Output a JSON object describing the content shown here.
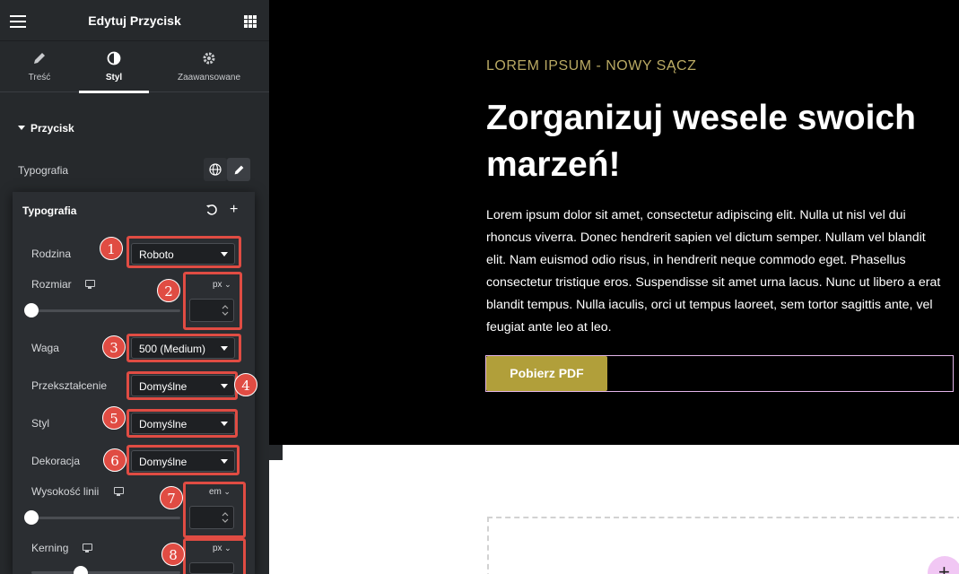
{
  "panel": {
    "title": "Edytuj Przycisk",
    "tabs": [
      {
        "label": "Treść",
        "icon": "pencil-icon"
      },
      {
        "label": "Styl",
        "icon": "half-circle-icon",
        "active": true
      },
      {
        "label": "Zaawansowane",
        "icon": "gear-icon"
      }
    ],
    "section_title": "Przycisk",
    "typography_label": "Typografia"
  },
  "popover": {
    "title": "Typografia",
    "fields": {
      "family": {
        "label": "Rodzina",
        "value": "Roboto"
      },
      "size": {
        "label": "Rozmiar",
        "unit": "px",
        "value": ""
      },
      "weight": {
        "label": "Waga",
        "value": "500 (Medium)"
      },
      "transform": {
        "label": "Przekształcenie",
        "value": "Domyślne"
      },
      "style": {
        "label": "Styl",
        "value": "Domyślne"
      },
      "decoration": {
        "label": "Dekoracja",
        "value": "Domyślne"
      },
      "line_height": {
        "label": "Wysokość linii",
        "unit": "em",
        "value": ""
      },
      "kerning": {
        "label": "Kerning",
        "unit": "px",
        "value": ""
      }
    }
  },
  "annotations": [
    "1",
    "2",
    "3",
    "4",
    "5",
    "6",
    "7",
    "8"
  ],
  "preview": {
    "eyebrow": "LOREM IPSUM - NOWY SĄCZ",
    "headline": "Zorganizuj wesele swoich marzeń!",
    "body": "Lorem ipsum dolor sit amet, consectetur adipiscing elit. Nulla ut nisl vel dui rhoncus viverra. Donec hendrerit sapien vel dictum semper. Nullam vel blandit elit. Nam euismod odio risus, in hendrerit neque commodo eget. Phasellus consectetur tristique eros. Suspendisse sit amet urna lacus. Nunc ut libero a erat blandit tempus. Nulla iaculis, orci ut tempus laoreet, sem tortor sagittis ante, vel feugiat ante leo at leo.",
    "button_label": "Pobierz PDF",
    "add_icon": "+"
  },
  "colors": {
    "accent_gold": "#b19f3a",
    "annotation_red": "#e04c43",
    "panel_bg": "#26292c"
  }
}
